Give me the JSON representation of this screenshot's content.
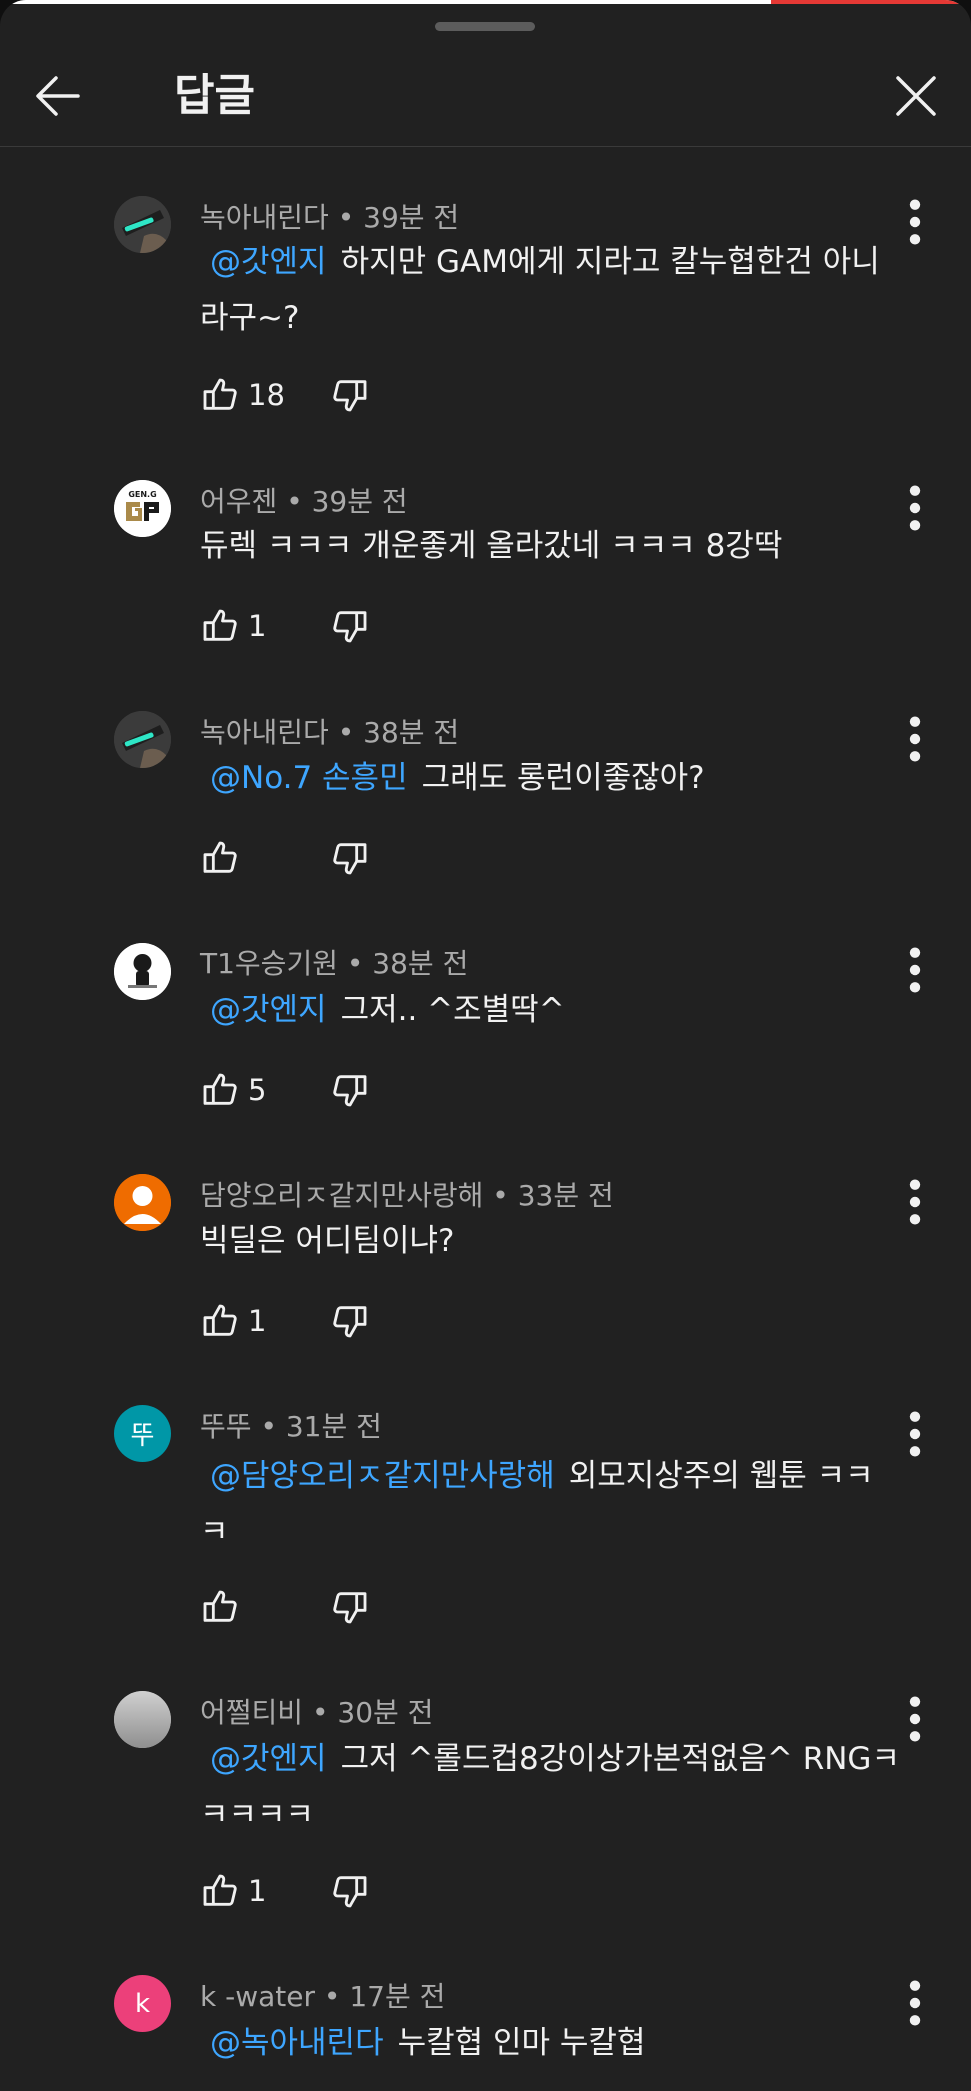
{
  "header": {
    "title": "답글"
  },
  "comments": [
    {
      "author": "녹아내린다",
      "time": "39분 전",
      "mention": "@갓엔지",
      "text": "하지만 GAM에게 지라고 칼누협한건 아니라구~?",
      "likes": "18",
      "avatar_letter": "",
      "avatar_color": "#3b3b3b"
    },
    {
      "author": "어우젠",
      "time": "39분 전",
      "mention": "",
      "text": "듀렉 ㅋㅋㅋ 개운좋게 올라갔네 ㅋㅋㅋ 8강딱",
      "likes": "1",
      "avatar_letter": "",
      "avatar_color": "#ffffff"
    },
    {
      "author": "녹아내린다",
      "time": "38분 전",
      "mention": "@No.7 손흥민",
      "text": "그래도 롱런이좋잖아?",
      "likes": "",
      "avatar_letter": "",
      "avatar_color": "#3b3b3b"
    },
    {
      "author": "T1우승기원",
      "time": "38분 전",
      "mention": "@갓엔지",
      "text": "그저.. ^조별딱^",
      "likes": "5",
      "avatar_letter": "",
      "avatar_color": "#ffffff"
    },
    {
      "author": "담양오리ㅈ같지만사랑해",
      "time": "33분 전",
      "mention": "",
      "text": "빅딜은 어디팀이냐?",
      "likes": "1",
      "avatar_letter": "",
      "avatar_color": "#ef6c00"
    },
    {
      "author": "뚜뚜",
      "time": "31분 전",
      "mention": "@담양오리ㅈ같지만사랑해",
      "text": "외모지상주의 웹툰 ㅋㅋㅋ",
      "likes": "",
      "avatar_letter": "뚜",
      "avatar_color": "#0097a7"
    },
    {
      "author": "어쩔티비",
      "time": "30분 전",
      "mention": "@갓엔지",
      "text": "그저 ^롤드컵8강이상가본적없음^ RNGㅋㅋㅋㅋㅋ",
      "likes": "1",
      "avatar_letter": "",
      "avatar_color": "#b8b8b8"
    },
    {
      "author": "k -water",
      "time": "17분 전",
      "mention": "@녹아내린다",
      "text": "누칼협 인마 누칼협",
      "likes": "",
      "avatar_letter": "k",
      "avatar_color": "#ec407a"
    }
  ],
  "separator": "•",
  "icons": {
    "back": "arrow-left-icon",
    "close": "close-icon",
    "menu": "more-vertical-icon",
    "like": "thumbs-up-icon",
    "dislike": "thumbs-down-icon"
  },
  "colors": {
    "background": "#212121",
    "mention": "#3ea6ff",
    "meta": "#aaaaaa",
    "text": "#f1f1f1"
  }
}
